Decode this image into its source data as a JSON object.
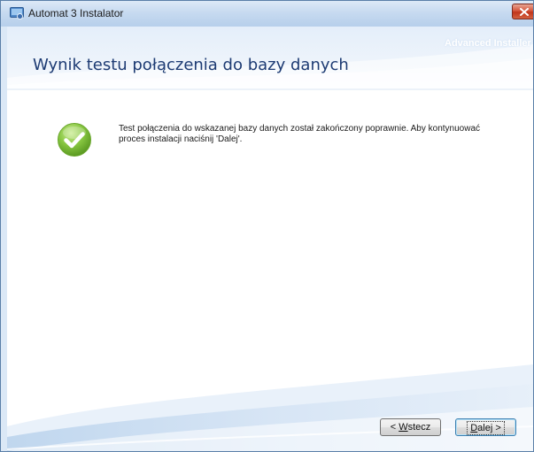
{
  "window": {
    "title": "Automat 3 Instalator"
  },
  "header": {
    "brand": "Advanced Installer",
    "title": "Wynik testu połączenia do bazy danych"
  },
  "content": {
    "message": "Test połączenia do wskazanej bazy danych został zakończony poprawnie. Aby kontynuować proces instalacji naciśnij 'Dalej'.",
    "status_icon": "success-check-icon"
  },
  "buttons": {
    "back_prefix": "< ",
    "back_accel": "W",
    "back_rest": "stecz",
    "next_accel": "D",
    "next_rest": "alej >"
  },
  "colors": {
    "title": "#1d3b73",
    "success_green": "#7cc23a",
    "accent_blue": "#5a7fa8"
  }
}
